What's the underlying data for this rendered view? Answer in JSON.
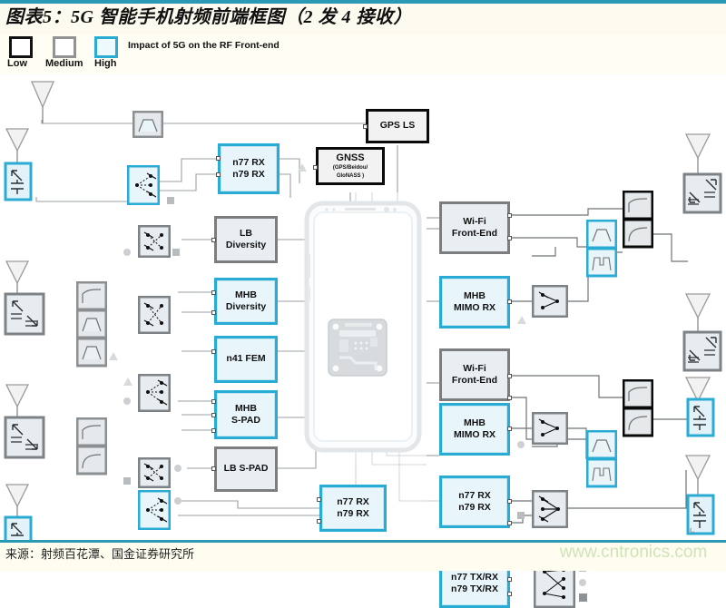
{
  "header": {
    "title": "图表5：5G 智能手机射频前端框图（2 发 4 接收）"
  },
  "legend": {
    "note": "Impact of 5G on the RF Front-end",
    "items": [
      {
        "label": "Low",
        "color": "#111111"
      },
      {
        "label": "Medium",
        "color": "#939393"
      },
      {
        "label": "High",
        "color": "#29abd4"
      }
    ]
  },
  "footer": {
    "source": "来源：射频百花潭、国金证券研究所",
    "watermark": "www.cntronics.com"
  },
  "colors": {
    "accent_cyan": "#29abd4",
    "accent_teal": "#2a9ab4",
    "gray_border": "#7d7d7d",
    "black_border": "#0a0a0a",
    "wire": "#8d9296",
    "block_fill_gray": "#e9eef2",
    "block_fill_cyan": "#e8f6fc"
  },
  "blocks": [
    {
      "id": "gps-ls",
      "label": "GPS LS",
      "impact": "Low"
    },
    {
      "id": "gnss",
      "label": "GNSS",
      "sub": "(GPS/Beidou/ GloNASS)",
      "impact": "Low"
    },
    {
      "id": "n77-n79-rx-1",
      "label": "n77 RX\nn79 RX",
      "impact": "High"
    },
    {
      "id": "lb-diversity",
      "label": "LB\nDiversity",
      "impact": "Medium"
    },
    {
      "id": "mhb-diversity",
      "label": "MHB\nDiversity",
      "impact": "High"
    },
    {
      "id": "n41-fem",
      "label": "n41 FEM",
      "impact": "High"
    },
    {
      "id": "mhb-s-pad",
      "label": "MHB\nS-PAD",
      "impact": "High"
    },
    {
      "id": "lb-s-pad",
      "label": "LB S-PAD",
      "impact": "Medium"
    },
    {
      "id": "n77-n79-rx-2",
      "label": "n77 RX\nn79 RX",
      "impact": "High"
    },
    {
      "id": "wifi-fe-1",
      "label": "Wi-Fi\nFront-End",
      "impact": "Medium"
    },
    {
      "id": "mhb-mimo-rx-1",
      "label": "MHB\nMIMO RX",
      "impact": "High"
    },
    {
      "id": "wifi-fe-2",
      "label": "Wi-Fi\nFront-End",
      "impact": "Medium"
    },
    {
      "id": "mhb-mimo-rx-2",
      "label": "MHB\nMIMO RX",
      "impact": "High"
    },
    {
      "id": "n77-n79-rx-3",
      "label": "n77 RX\nn79 RX",
      "impact": "High"
    },
    {
      "id": "n77-n79-txrx",
      "label": "n77 TX/RX\nn79 TX/RX",
      "impact": "High"
    }
  ],
  "labels": {
    "gps_ls": "GPS LS",
    "gnss": "GNSS",
    "gnss_sub1": "(GPS/Beidou/",
    "gnss_sub2": "GloNASS )",
    "n77_rx": "n77 RX",
    "n79_rx": "n79 RX",
    "lb": "LB",
    "diversity": "Diversity",
    "mhb": "MHB",
    "n41_fem": "n41 FEM",
    "s_pad": "S-PAD",
    "lb_s_pad": "LB S-PAD",
    "wifi": "Wi-Fi",
    "front_end": "Front-End",
    "mimo_rx": "MIMO RX",
    "n77_txrx": "n77 TX/RX",
    "n79_txrx": "n79 TX/RX"
  },
  "counts": {
    "antennas": 9,
    "antenna_tuners": 9,
    "switches": 9,
    "filter_banks": 7
  }
}
